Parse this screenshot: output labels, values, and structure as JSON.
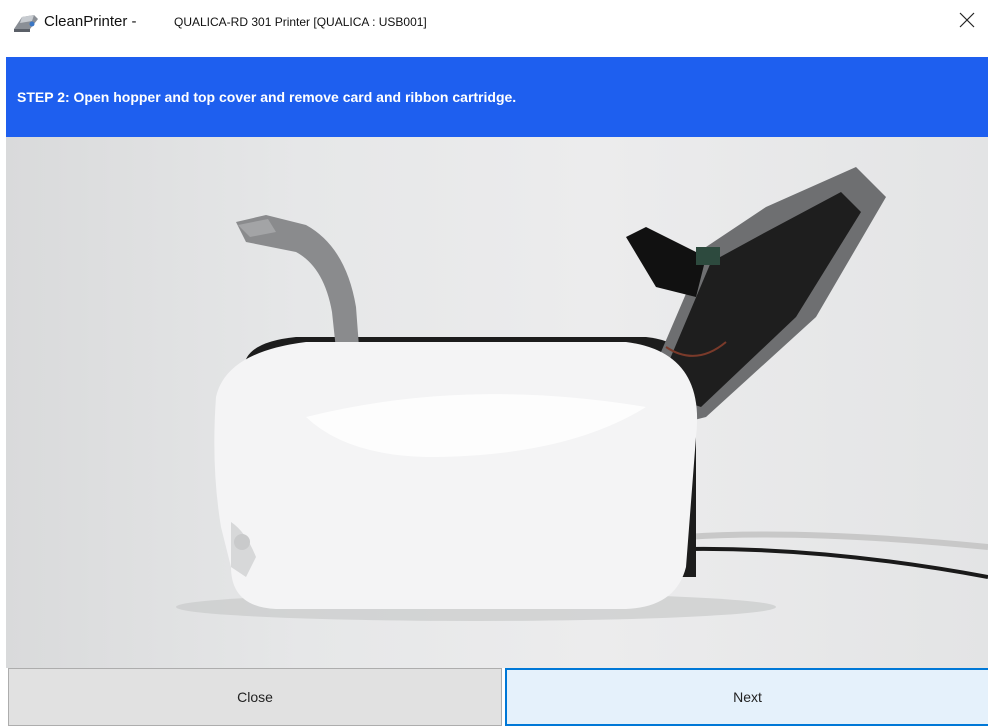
{
  "window": {
    "app_name": "CleanPrinter - ",
    "device_label": "QUALICA-RD 301 Printer [QUALICA : USB001]",
    "app_icon": "cleanprinter-app-icon",
    "close_icon": "close-icon"
  },
  "step": {
    "text": "STEP 2:  Open hopper and top cover and remove card and ribbon cartridge.",
    "banner_color": "#1e5fef"
  },
  "illustration": {
    "subject": "card printer with hopper and top cover open"
  },
  "buttons": {
    "close_label": "Close",
    "next_label": "Next"
  },
  "colors": {
    "accent": "#0078d7",
    "banner": "#1e5fef"
  }
}
